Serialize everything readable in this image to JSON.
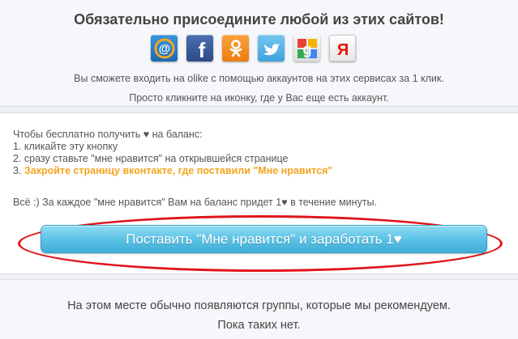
{
  "connect": {
    "title": "Обязательно присоедините любой из этих сайтов!",
    "services": [
      {
        "name": "mail-ru",
        "icon": "at-sign-icon",
        "glyph": "@",
        "color": "#1e7ac7"
      },
      {
        "name": "facebook",
        "icon": "facebook-icon",
        "glyph": "f",
        "color": "#3b5b99"
      },
      {
        "name": "odnoklassniki",
        "icon": "odnoklassniki-icon",
        "glyph": "",
        "color": "#f58a1f"
      },
      {
        "name": "twitter",
        "icon": "twitter-icon",
        "glyph": "",
        "color": "#55b0e6"
      },
      {
        "name": "google",
        "icon": "google-icon",
        "glyph": "g",
        "color": "#e8e8e8"
      },
      {
        "name": "yandex",
        "icon": "yandex-icon",
        "glyph": "Я",
        "color": "#f2f2f2"
      }
    ],
    "line1": "Вы сможете входить на olike с помощью аккаунтов на этих сервисах за 1 клик.",
    "line2": "Просто кликните на иконку, где у Вас еще есть аккаунт."
  },
  "instructions": {
    "intro": "Чтобы бесплатно получить ♥ на баланс:",
    "step1": "1. кликайте эту кнопку",
    "step2": "2. сразу ставьте \"мне нравится\" на открывшейся странице",
    "step3_num": "3. ",
    "step3": "Закройте страницу вконтакте, где поставили \"Мне нравится\"",
    "note": "Всё :) За каждое \"мне нравится\" Вам на баланс придет 1♥ в течение минуты."
  },
  "cta": {
    "label": "Поставить \"Мне нравится\" и заработать 1♥"
  },
  "groups": {
    "line1": "На этом месте обычно появляются группы, которые мы рекомендуем.",
    "line2": "Пока таких нет."
  },
  "colors": {
    "highlight": "#f3a51e",
    "cta_blue": "#5cc3e6",
    "annotation_red": "#e0141b"
  }
}
